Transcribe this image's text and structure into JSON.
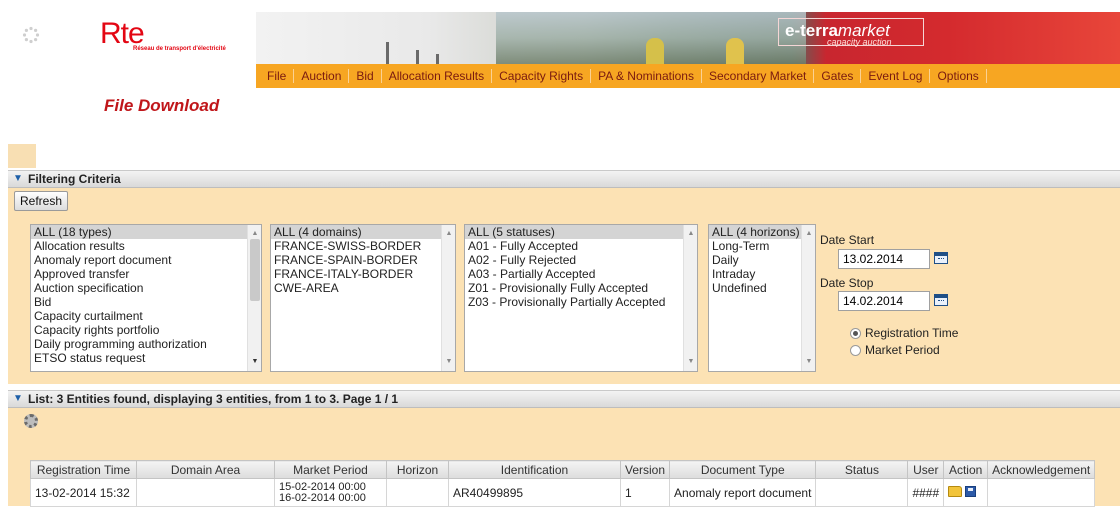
{
  "brand": {
    "logo_text": "Rte",
    "logo_subtitle": "Réseau de transport d'électricité",
    "product_name_bold": "e-terra",
    "product_name_italic": "market",
    "product_tagline": "capacity auction"
  },
  "menu": [
    {
      "label": "File"
    },
    {
      "label": "Auction"
    },
    {
      "label": "Bid"
    },
    {
      "label": "Allocation Results"
    },
    {
      "label": "Capacity Rights"
    },
    {
      "label": "PA & Nominations"
    },
    {
      "label": "Secondary Market"
    },
    {
      "label": "Gates"
    },
    {
      "label": "Event Log"
    },
    {
      "label": "Options"
    }
  ],
  "page_title": "File Download",
  "filter": {
    "header": "Filtering Criteria",
    "refresh_label": "Refresh",
    "types": [
      "ALL (18 types)",
      "Allocation results",
      "Anomaly report document",
      "Approved transfer",
      "Auction specification",
      "Bid",
      "Capacity curtailment",
      "Capacity rights portfolio",
      "Daily programming authorization",
      "ETSO status request"
    ],
    "domains": [
      "ALL (4 domains)",
      "FRANCE-SWISS-BORDER",
      "FRANCE-SPAIN-BORDER",
      "FRANCE-ITALY-BORDER",
      "CWE-AREA"
    ],
    "statuses": [
      "ALL (5 statuses)",
      "A01 - Fully Accepted",
      "A02 - Fully Rejected",
      "A03 - Partially Accepted",
      "Z01 - Provisionally Fully Accepted",
      "Z03 - Provisionally Partially Accepted"
    ],
    "horizons": [
      "ALL (4 horizons)",
      "Long-Term",
      "Daily",
      "Intraday",
      "Undefined"
    ],
    "date_start_label": "Date Start",
    "date_start_value": "13.02.2014",
    "date_stop_label": "Date Stop",
    "date_stop_value": "14.02.2014",
    "radio_registration_label": "Registration Time",
    "radio_market_label": "Market Period",
    "selected_radio": "registration"
  },
  "list": {
    "header": "List: 3 Entities found, displaying 3 entities, from 1 to 3. Page 1 / 1",
    "columns": [
      "Registration Time",
      "Domain Area",
      "Market Period",
      "Horizon",
      "Identification",
      "Version",
      "Document Type",
      "Status",
      "User",
      "Action",
      "Acknowledgement"
    ],
    "rows": [
      {
        "registration_time": "13-02-2014 15:32",
        "domain_area": "",
        "market_period_start": "15-02-2014 00:00",
        "market_period_end": "16-02-2014 00:00",
        "horizon": "",
        "identification": "AR40499895",
        "version": "1",
        "document_type": "Anomaly report document",
        "status": "",
        "user": "####",
        "acknowledgement": ""
      }
    ]
  },
  "colors": {
    "menu_bg": "#f7a622",
    "panel_bg": "#fce2b4",
    "title_red": "#c0161a"
  }
}
